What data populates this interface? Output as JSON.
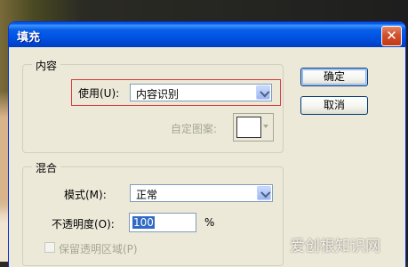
{
  "dialog": {
    "title": "填充",
    "close_glyph": "✕"
  },
  "content_group": {
    "legend": "内容",
    "use_label": "使用(U):",
    "use_value": "内容识别",
    "custom_pattern_label": "自定图案:"
  },
  "buttons": {
    "ok": "确定",
    "cancel": "取消"
  },
  "blend_group": {
    "legend": "混合",
    "mode_label": "模式(M):",
    "mode_value": "正常",
    "opacity_label": "不透明度(O):",
    "opacity_value": "100",
    "opacity_unit": "%",
    "preserve_label": "保留透明区域(P)"
  },
  "watermark": "爱创根知识网",
  "colors": {
    "titlebar": "#0055e5",
    "highlight_border": "#d63a3a",
    "selection": "#316ac5"
  }
}
